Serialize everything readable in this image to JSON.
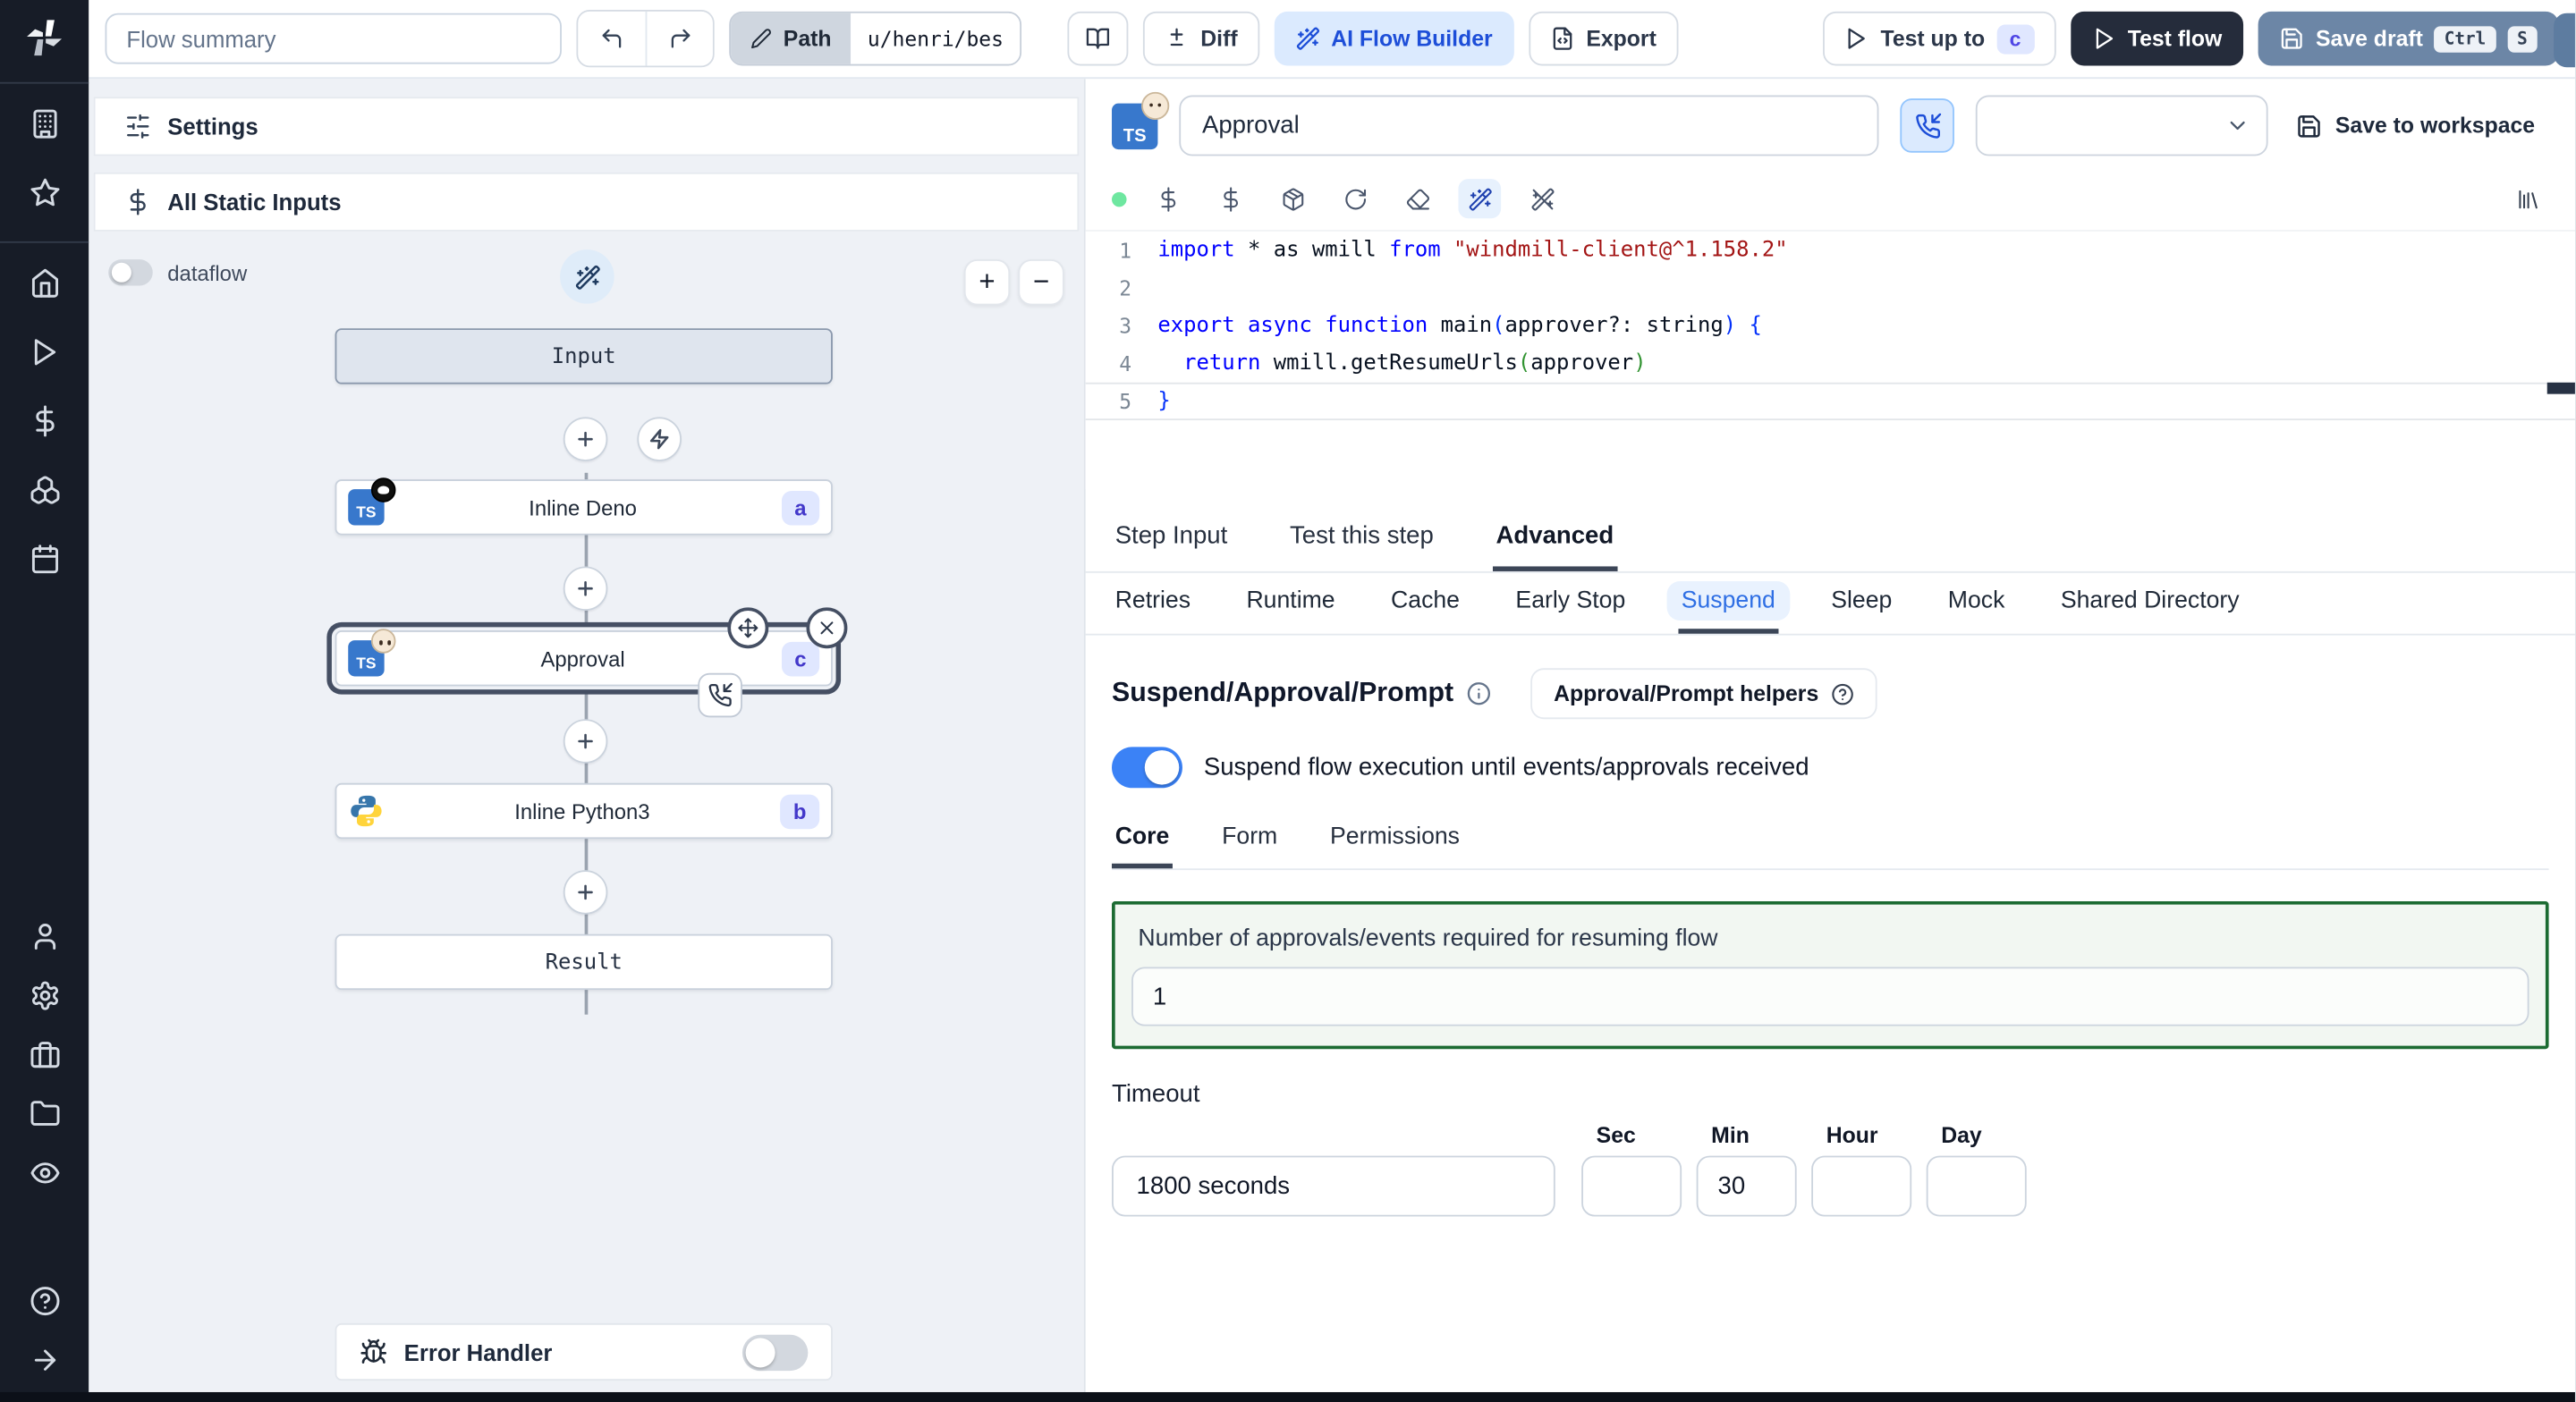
{
  "topbar": {
    "flow_summary_placeholder": "Flow summary",
    "path_button": "Path",
    "path_value": "u/henri/bes",
    "diff": "Diff",
    "ai_flow_builder": "AI Flow Builder",
    "export": "Export",
    "test_up_to": "Test up to",
    "test_up_to_badge": "c",
    "test_flow": "Test flow",
    "save_draft": "Save draft",
    "kbd_ctrl": "Ctrl",
    "kbd_s": "S"
  },
  "flow_panel": {
    "settings": "Settings",
    "all_static_inputs": "All Static Inputs",
    "dataflow_label": "dataflow",
    "zoom_in": "+",
    "zoom_out": "−",
    "nodes": {
      "input": "Input",
      "deno": {
        "label": "Inline Deno",
        "badge": "a"
      },
      "approval": {
        "label": "Approval",
        "badge": "c"
      },
      "python": {
        "label": "Inline Python3",
        "badge": "b"
      },
      "result": "Result"
    },
    "error_handler": "Error Handler"
  },
  "step_panel": {
    "name_value": "Approval",
    "save_to_workspace": "Save to workspace",
    "code": {
      "lines": [
        [
          [
            "kw",
            "import"
          ],
          [
            "pl",
            " * as wmill "
          ],
          [
            "kw",
            "from"
          ],
          [
            "pl",
            " "
          ],
          [
            "st",
            "\"windmill-client@^1.158.2\""
          ]
        ],
        [],
        [
          [
            "kw",
            "export"
          ],
          [
            "pl",
            " "
          ],
          [
            "kw",
            "async"
          ],
          [
            "pl",
            " "
          ],
          [
            "kw",
            "function"
          ],
          [
            "pl",
            " main"
          ],
          [
            "pb",
            "("
          ],
          [
            "pl",
            "approver?: string"
          ],
          [
            "pb",
            ")"
          ],
          [
            "pl",
            " "
          ],
          [
            "pb",
            "{"
          ]
        ],
        [
          [
            "pl",
            "  "
          ],
          [
            "kw",
            "return"
          ],
          [
            "pl",
            " wmill.getResumeUrls"
          ],
          [
            "pg",
            "("
          ],
          [
            "pl",
            "approver"
          ],
          [
            "pg",
            ")"
          ]
        ],
        [
          [
            "pb",
            "}"
          ]
        ]
      ]
    },
    "tabs": [
      "Step Input",
      "Test this step",
      "Advanced"
    ],
    "subtabs": [
      "Retries",
      "Runtime",
      "Cache",
      "Early Stop",
      "Suspend",
      "Sleep",
      "Mock",
      "Shared Directory"
    ],
    "suspend": {
      "title": "Suspend/Approval/Prompt",
      "helpers_button": "Approval/Prompt helpers",
      "toggle_label": "Suspend flow execution until events/approvals received",
      "inner_tabs": [
        "Core",
        "Form",
        "Permissions"
      ],
      "approvals_label": "Number of approvals/events required for resuming flow",
      "approvals_value": "1",
      "timeout_label": "Timeout",
      "timeout_value": "1800 seconds",
      "units": [
        {
          "label": "Sec",
          "value": ""
        },
        {
          "label": "Min",
          "value": "30"
        },
        {
          "label": "Hour",
          "value": ""
        },
        {
          "label": "Day",
          "value": ""
        }
      ]
    }
  },
  "colors": {
    "accent_blue": "#2f6fe4",
    "toggle_on": "#3b82f6",
    "selected_node_ring": "#454f63",
    "green_box_border": "#1c6b32",
    "badge_bg": "#e0e7ff",
    "badge_text": "#4338ca",
    "sidebar_bg": "#171c27",
    "test_flow_bg": "#252c3b",
    "save_draft_bg": "#6c86a6"
  }
}
